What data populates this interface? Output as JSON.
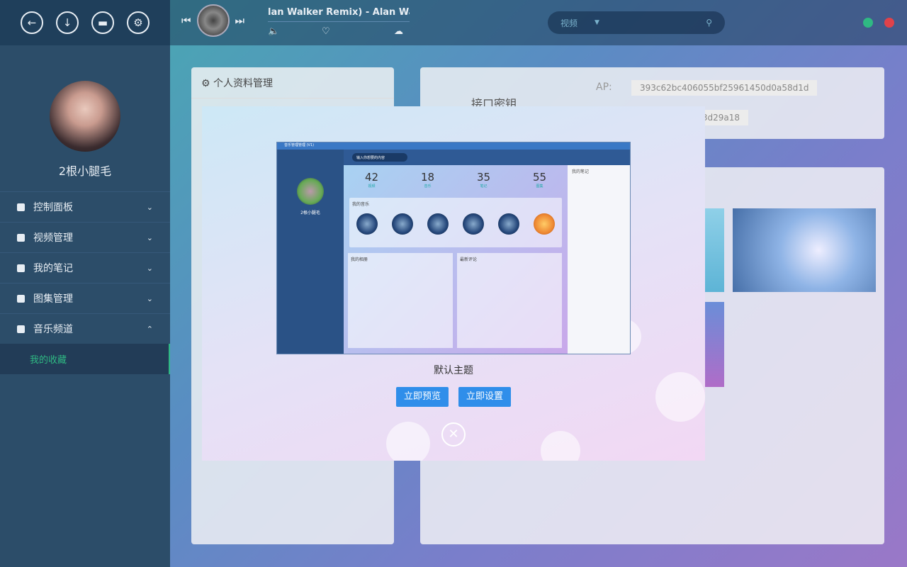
{
  "sidebar": {
    "top_icons": [
      "back-arrow-icon",
      "download-icon",
      "chat-icon",
      "gear-icon"
    ],
    "username": "2根小腿毛",
    "menu": [
      {
        "label": "控制面板",
        "expanded": false
      },
      {
        "label": "视频管理",
        "expanded": false
      },
      {
        "label": "我的笔记",
        "expanded": false
      },
      {
        "label": "图集管理",
        "expanded": false
      },
      {
        "label": "音乐频道",
        "expanded": true
      }
    ],
    "submenu": [
      {
        "label": "我的收藏"
      }
    ]
  },
  "player": {
    "song_title": "lan Walker Remix) - Alan Walker"
  },
  "search": {
    "category": "视频",
    "placeholder": ""
  },
  "window_controls": {
    "minimize_color": "#2fb983",
    "close_color": "#e0424a"
  },
  "profile_panel": {
    "title": "个人资料管理"
  },
  "api_panel": {
    "title": "接口密钥",
    "label": "AP:",
    "key1": "393c62bc406055bf25961450d0a58d1d",
    "key2": "6ad92b29f0643d29a18"
  },
  "theme_modal": {
    "theme_name": "默认主题",
    "preview_button": "立即预览",
    "apply_button": "立即设置",
    "preview": {
      "app_title": "音乐管理管理 (V1)",
      "username": "2根小腿毛",
      "nav_search": "输入你想要的内容",
      "stats": [
        {
          "value": "42",
          "label": "视频"
        },
        {
          "value": "18",
          "label": "音乐"
        },
        {
          "value": "35",
          "label": "笔记"
        },
        {
          "value": "55",
          "label": "图集"
        }
      ],
      "music_title": "我的音乐",
      "gallery_title": "我的相册",
      "comments_title": "最新评论",
      "notes_title": "我的笔记"
    }
  }
}
